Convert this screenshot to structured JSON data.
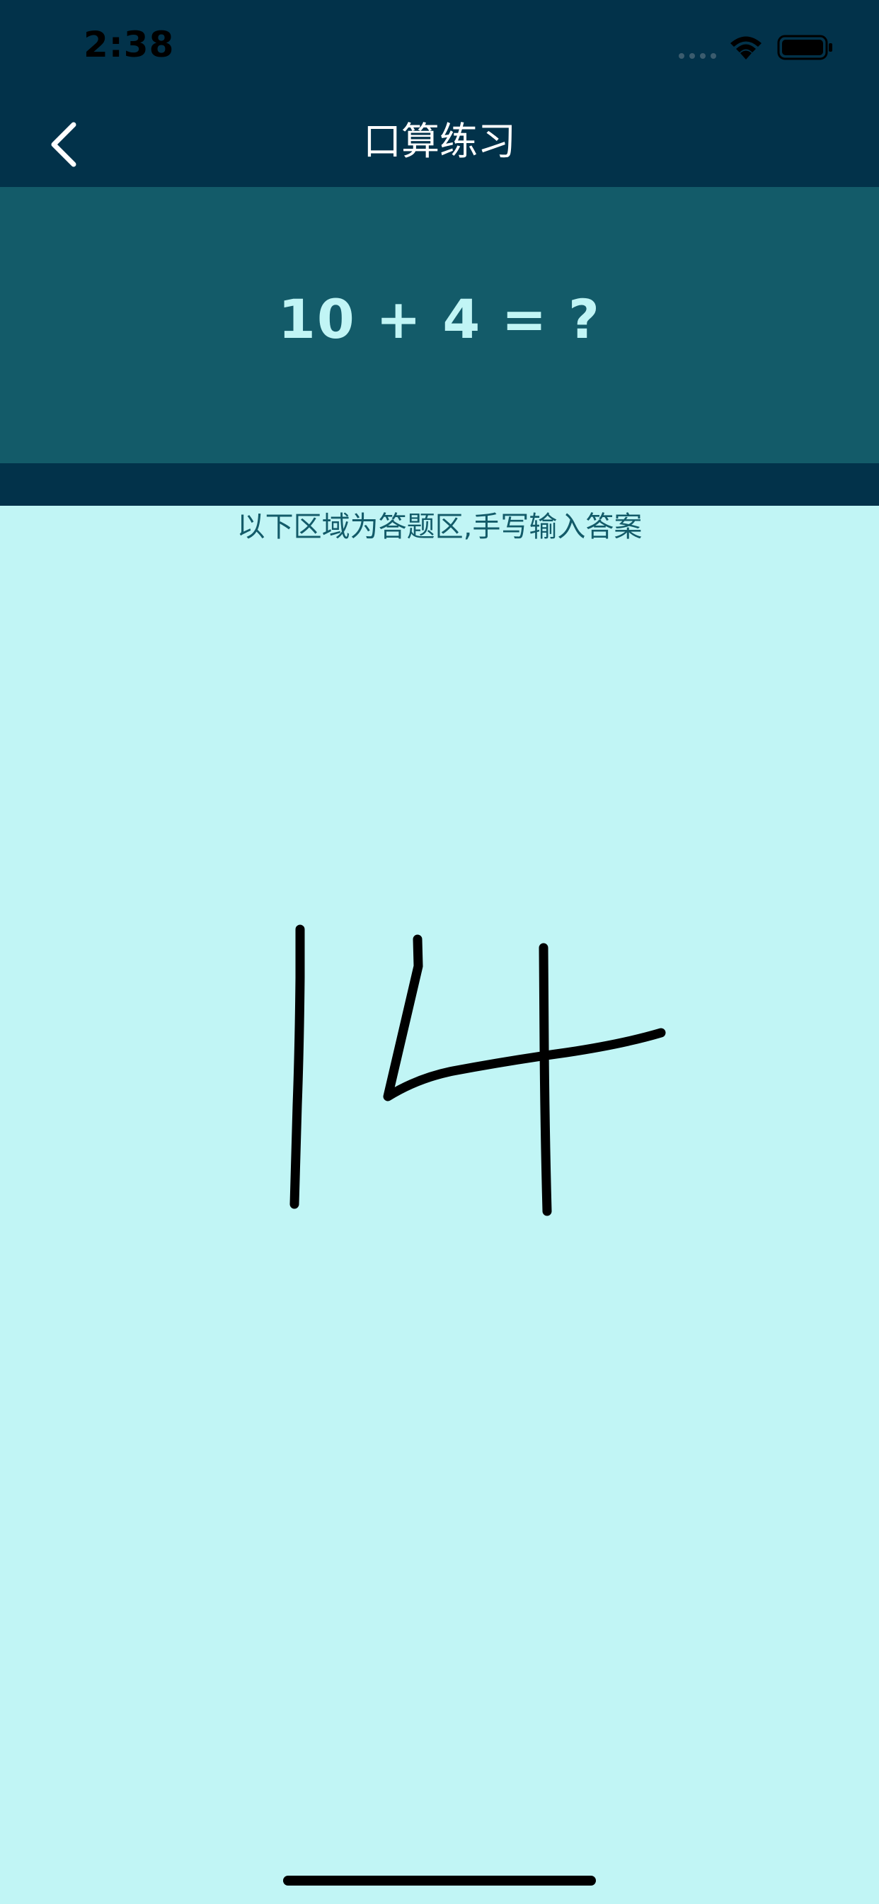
{
  "status_bar": {
    "time": "2:38"
  },
  "nav": {
    "title": "口算练习",
    "back_icon": "chevron-left-icon"
  },
  "question": {
    "text": "10 + 4 = ?"
  },
  "instruction": "以下区域为答题区,手写输入答案",
  "colors": {
    "header_bg": "#02324a",
    "question_bg": "#135b69",
    "question_text": "#c1f5f5",
    "canvas_bg": "#c1f5f5",
    "instruction_text": "#135b69",
    "ink": "#000000"
  }
}
